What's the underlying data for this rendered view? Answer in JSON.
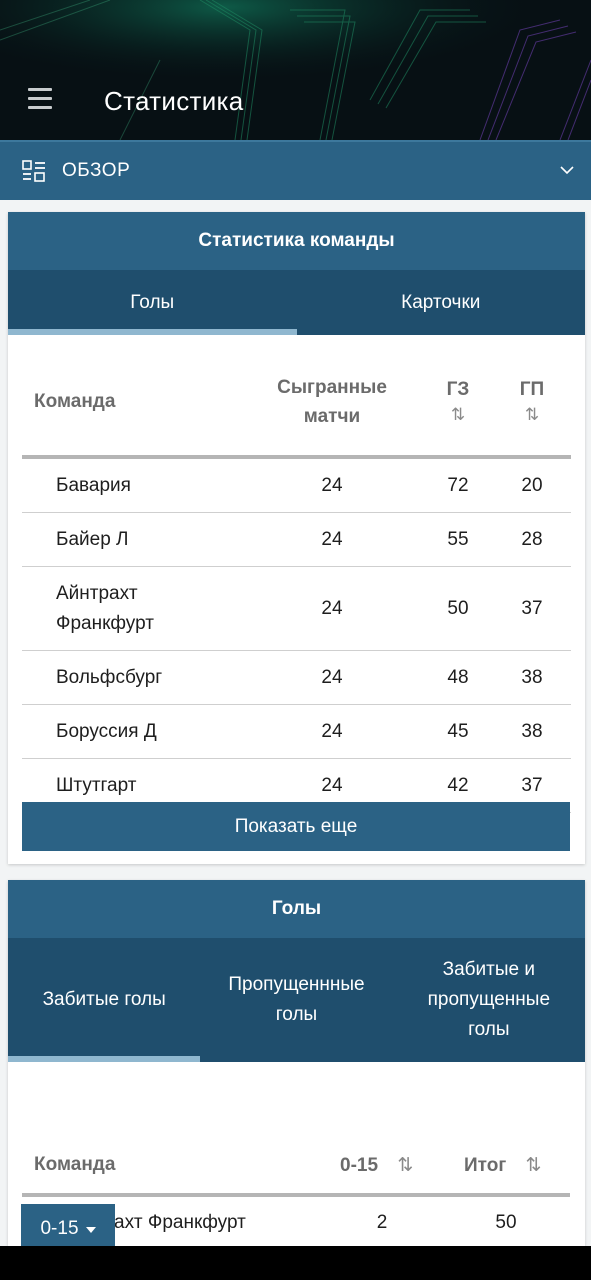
{
  "header": {
    "title": "Статистика",
    "menu_icon": "hamburger-icon"
  },
  "overview": {
    "label": "ОБЗОР",
    "icon": "overview-icon",
    "chevron": "chevron-down-icon"
  },
  "team_stats": {
    "title": "Статистика команды",
    "tabs": [
      {
        "label": "Голы",
        "active": true
      },
      {
        "label": "Карточки",
        "active": false
      }
    ],
    "columns": {
      "team": "Команда",
      "played_line1": "Сыгранные",
      "played_line2": "матчи",
      "gf": "ГЗ",
      "ga": "ГП",
      "sort_glyph": "⇅"
    },
    "rows": [
      {
        "team": "Бавария",
        "played": "24",
        "gf": "72",
        "ga": "20"
      },
      {
        "team": "Байер Л",
        "played": "24",
        "gf": "55",
        "ga": "28"
      },
      {
        "team_line1": "Айнтрахт",
        "team_line2": "Франкфурт",
        "played": "24",
        "gf": "50",
        "ga": "37"
      },
      {
        "team": "Вольфсбург",
        "played": "24",
        "gf": "48",
        "ga": "38"
      },
      {
        "team": "Боруссия Д",
        "played": "24",
        "gf": "45",
        "ga": "38"
      },
      {
        "team": "Штутгарт",
        "played": "24",
        "gf": "42",
        "ga": "37"
      }
    ],
    "more_label": "Показать еще"
  },
  "goals": {
    "title": "Голы",
    "tabs": [
      {
        "label": "Забитые голы",
        "active": true
      },
      {
        "label_line1": "Пропущеннные",
        "label_line2": "голы",
        "active": false
      },
      {
        "label_line1": "Забитые и",
        "label_line2": "пропущенные",
        "label_line3": "голы",
        "active": false
      }
    ],
    "range": "0-15",
    "columns": {
      "team": "Команда",
      "range": "0-15",
      "total": "Итог",
      "sort_glyph": "⇅"
    },
    "rows": [
      {
        "team": "Айнтрахт Франкфурт",
        "range": "2",
        "total": "50"
      }
    ]
  },
  "colors": {
    "primary": "#2b6285",
    "tab_bg": "#1f4e6d",
    "tab_indicator": "#8fb7cf",
    "header_bg": "#071014"
  }
}
